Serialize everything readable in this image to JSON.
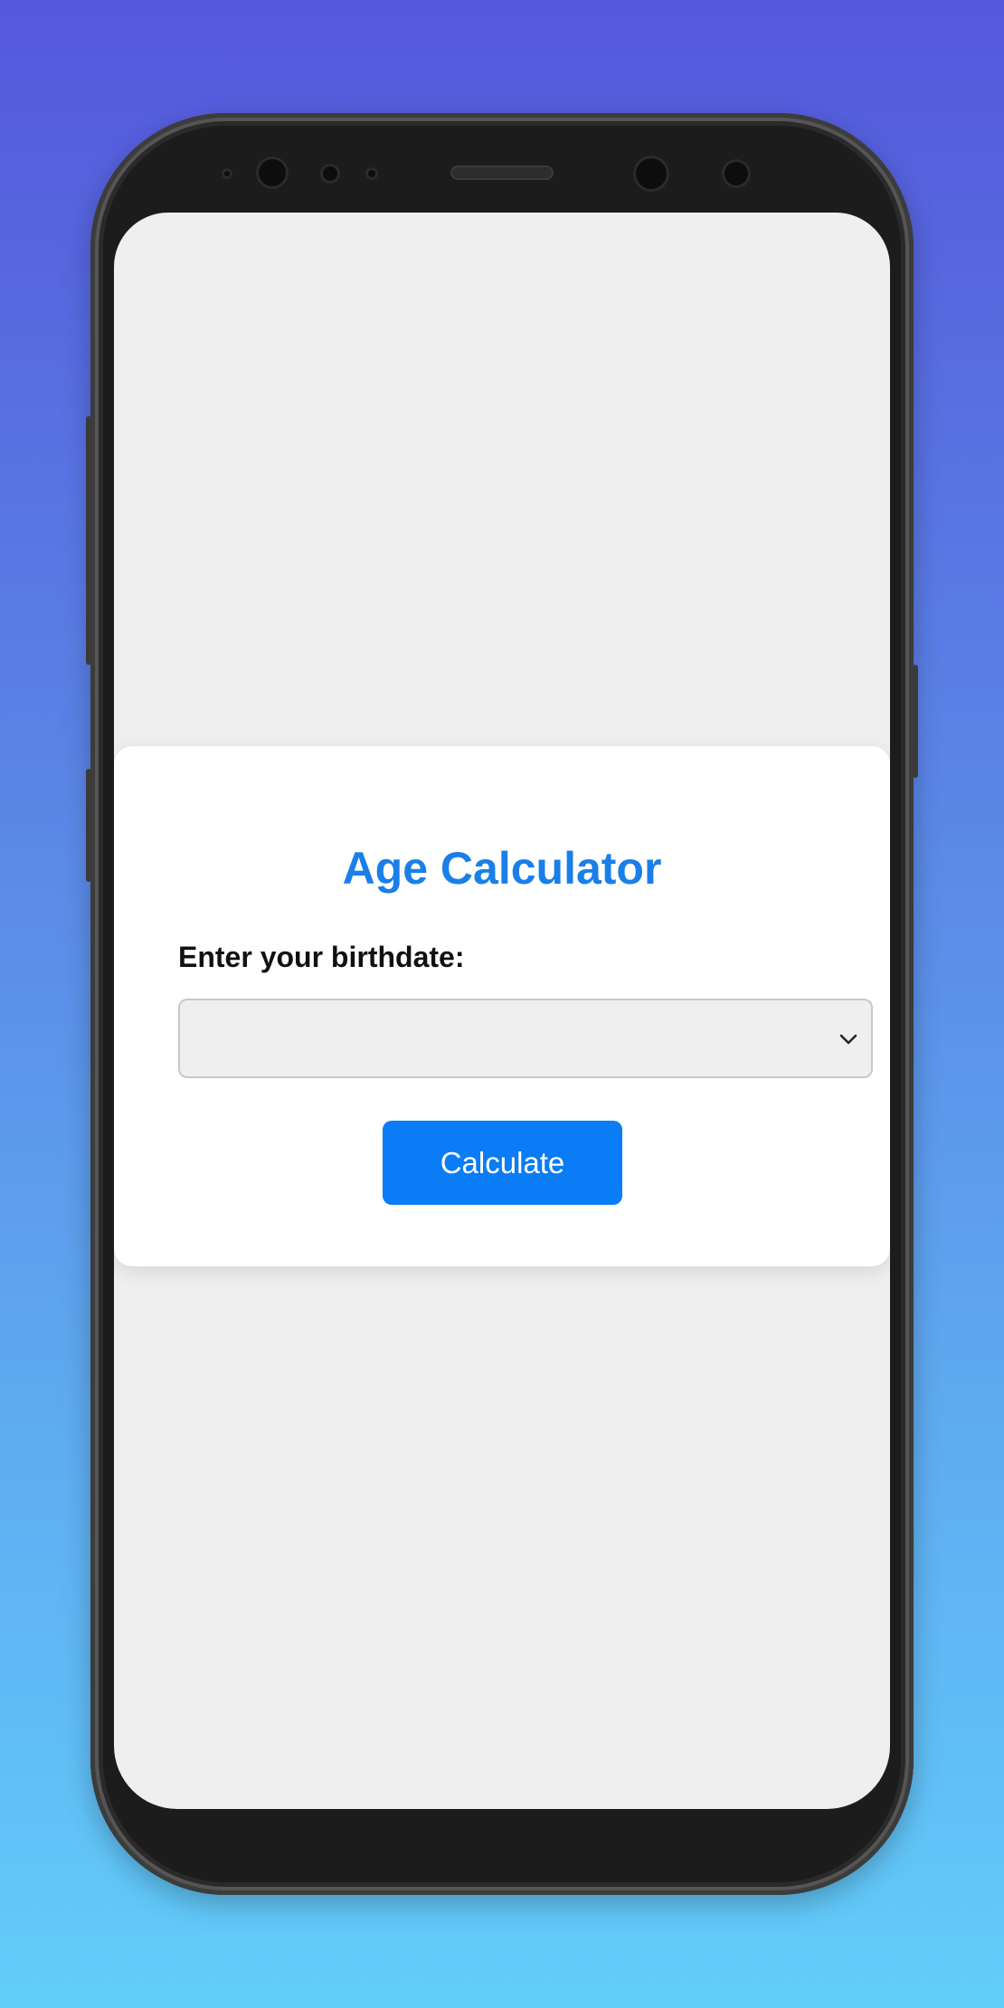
{
  "app": {
    "title": "Age Calculator",
    "accent_color": "#1a7fe8",
    "button_color": "#0a7cf5"
  },
  "form": {
    "birthdate_label": "Enter your birthdate:",
    "birthdate_value": "",
    "dropdown_icon": "chevron-down-icon",
    "calculate_label": "Calculate"
  }
}
